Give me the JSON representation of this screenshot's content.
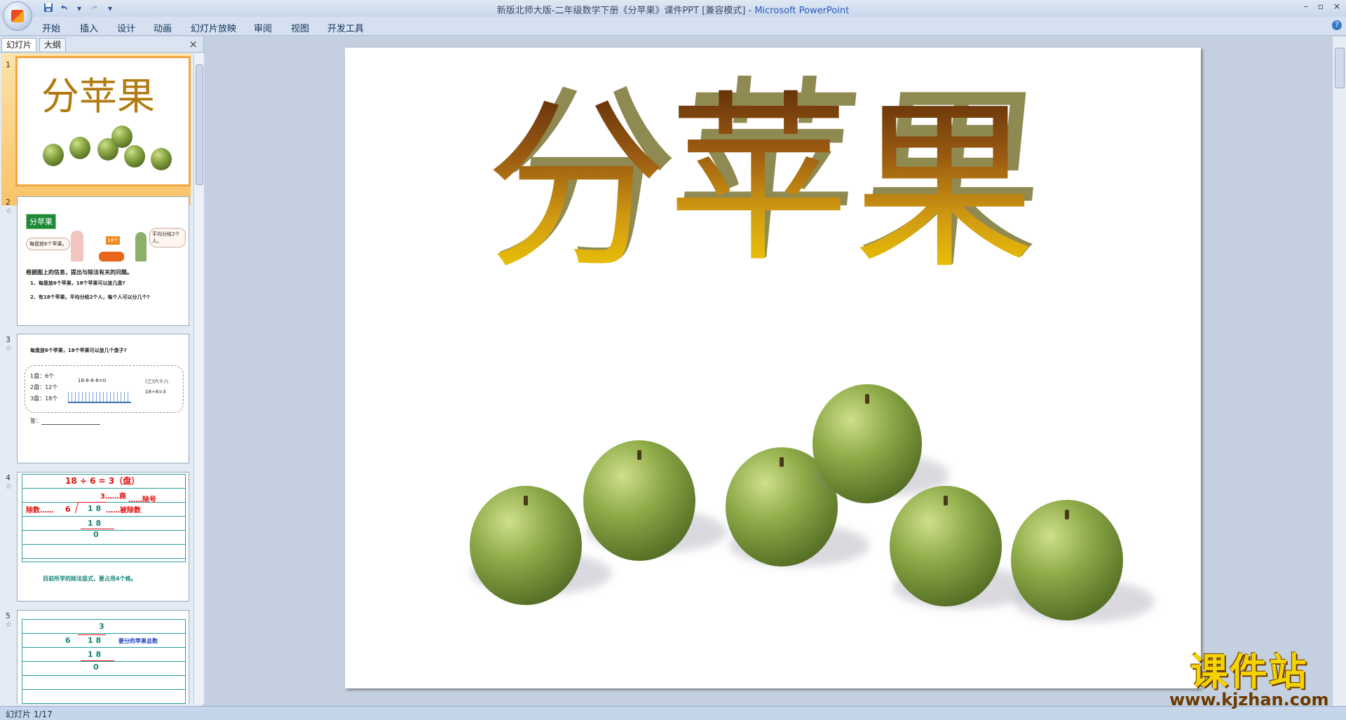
{
  "window": {
    "title_doc": "新版北师大版-二年级数学下册《分苹果》课件PPT [兼容模式] - ",
    "title_app": "Microsoft PowerPoint",
    "minimize": "–",
    "restore": "▫",
    "close": "×"
  },
  "qat": {
    "save_icon": "save-icon",
    "undo_icon": "undo-icon",
    "redo_icon": "redo-icon",
    "dropdown": "▾"
  },
  "ribbon_tabs": [
    "开始",
    "插入",
    "设计",
    "动画",
    "幻灯片放映",
    "审阅",
    "视图",
    "开发工具"
  ],
  "help": "?",
  "panel": {
    "tab_slides": "幻灯片",
    "tab_outline": "大纲",
    "close": "×"
  },
  "thumbs": {
    "nums": [
      "1",
      "2",
      "3",
      "4",
      "5"
    ],
    "star": "☆",
    "t1_title": "分苹果",
    "t2": {
      "badge": "分苹果",
      "bubble_left": "每盘放6个苹果。",
      "sign": "18个",
      "bubble_right": "平均分给2个人。",
      "prompt": "根据图上的信息，提出与除法有关的问题。",
      "q1": "1、每盘放6个苹果，18个苹果可以放几盘?",
      "q2": "2、有18个苹果，平均分给2个人，每个人可以分几个?"
    },
    "t3": {
      "question": "每盘放6个苹果，18个苹果可以放几个盘子?",
      "l1": "1盘：6个",
      "l2": "2盘：12个",
      "l3": "3盘：18个",
      "eq": "18-6-6-6=0",
      "right1": "(三)六十八",
      "right2": "18÷6=3",
      "answer": "答："
    },
    "t4": {
      "top": "18 ÷ 6 = 3（盘）",
      "q": "3……商",
      "divisor_label": "……除号",
      "left": "除数……",
      "six": "6",
      "dividend": "1 8",
      "dividend_label": "……被除数",
      "product": "1 8",
      "zero": "0",
      "note": "目前所学的除法竖式，要占用4个格。"
    },
    "t5": {
      "q": "3",
      "six": "6",
      "dividend": "1 8",
      "label": "要分的苹果总数",
      "product": "1 8",
      "zero": "0"
    }
  },
  "slide": {
    "title_chars": [
      "分",
      "苹",
      "果"
    ]
  },
  "watermark": {
    "brand": "课件站",
    "url": "www.kjzhan.com"
  },
  "status": {
    "text": "幻灯片 1/17"
  }
}
